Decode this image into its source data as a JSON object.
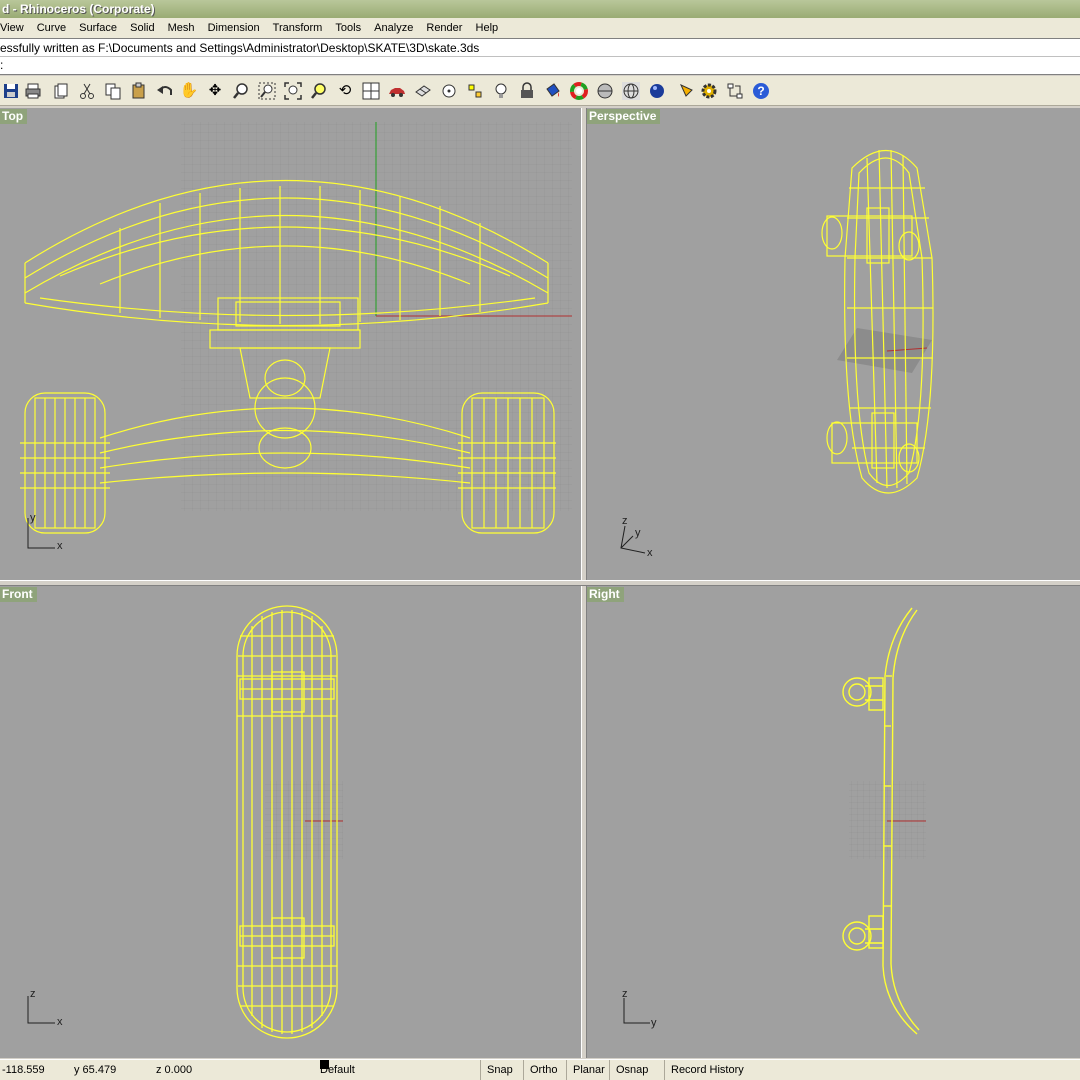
{
  "window": {
    "title": "d - Rhinoceros (Corporate)"
  },
  "menu": [
    "View",
    "Curve",
    "Surface",
    "Solid",
    "Mesh",
    "Dimension",
    "Transform",
    "Tools",
    "Analyze",
    "Render",
    "Help"
  ],
  "command": {
    "history": "essfully written as F:\\Documents and Settings\\Administrator\\Desktop\\SKATE\\3D\\skate.3ds",
    "prompt": ":",
    "input_value": ""
  },
  "toolbar": {
    "icons": [
      "save-icon",
      "print-icon",
      "copy-doc-icon",
      "cut-icon",
      "copy-icon",
      "paste-icon",
      "undo-icon",
      "pan-hand-icon",
      "move-icon",
      "zoom-icon",
      "zoom-window-icon",
      "zoom-extents-icon",
      "zoom-selected-icon",
      "rotate-view-icon",
      "four-viewports-icon",
      "car-icon",
      "grid-snap-icon",
      "circle-point-icon",
      "points-icon",
      "light-bulb-icon",
      "lock-icon",
      "paint-bucket-icon",
      "color-wheel-icon",
      "shaded-sphere-icon",
      "wireframe-sphere-icon",
      "render-sphere-icon",
      "pen-icon",
      "gear-icon",
      "history-icon",
      "help-icon"
    ]
  },
  "viewports": {
    "top": {
      "label": "Top",
      "axis_a": "y",
      "axis_b": "x"
    },
    "perspective": {
      "label": "Perspective",
      "axis_a": "z",
      "axis_b": "y",
      "axis_c": "x"
    },
    "front": {
      "label": "Front",
      "axis_a": "z",
      "axis_b": "x"
    },
    "right": {
      "label": "Right",
      "axis_a": "z",
      "axis_b": "y"
    }
  },
  "colors": {
    "wireframe": "#ffff33",
    "viewport_bg": "#a0a0a0",
    "grid": "#8c8c8c",
    "x_axis": "#b03030",
    "y_axis": "#20a020"
  },
  "status": {
    "x": "-118.559",
    "y": "y 65.479",
    "z": "z 0.000",
    "layer": "Default",
    "snap": "Snap",
    "ortho": "Ortho",
    "planar": "Planar",
    "osnap": "Osnap",
    "record_history": "Record History"
  }
}
